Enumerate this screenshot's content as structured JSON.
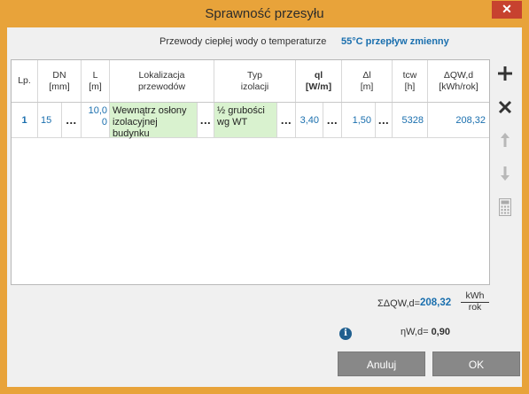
{
  "window": {
    "title": "Sprawność przesyłu",
    "close_symbol": "✕"
  },
  "subheader": {
    "label": "Przewody ciepłej wody o temperaturze",
    "value": "55°C przepływ zmienny"
  },
  "table": {
    "headers": {
      "lp": "Lp.",
      "dn_1": "DN",
      "dn_2": "[mm]",
      "l_1": "L",
      "l_2": "[m]",
      "lok_1": "Lokalizacja",
      "lok_2": "przewodów",
      "typ_1": "Typ",
      "typ_2": "izolacji",
      "ql_1": "ql",
      "ql_2": "[W/m]",
      "dl_1": "Δl",
      "dl_2": "[m]",
      "tcw_1": "tcw",
      "tcw_2": "[h]",
      "dq_1": "ΔQW,d",
      "dq_2": "[kWh/rok]"
    },
    "rows": [
      {
        "lp": "1",
        "dn": "15",
        "l_1": "10,0",
        "l_2": "0",
        "lok_1": "Wewnątrz osłony",
        "lok_2": "izolacyjnej budynku",
        "typ_1": "½ grubości",
        "typ_2": "wg WT",
        "ql": "3,40",
        "dl": "1,50",
        "tcw": "5328",
        "dq": "208,32"
      }
    ],
    "dots": "..."
  },
  "summary": {
    "sum_label": "ΣΔQW,d=",
    "sum_value": "208,32",
    "unit_top": "kWh",
    "unit_bottom": "rok",
    "eff_label": "ηW,d=",
    "eff_value": "0,90",
    "info_symbol": "i"
  },
  "buttons": {
    "cancel": "Anuluj",
    "ok": "OK"
  },
  "colors": {
    "accent": "#e8a33a",
    "link_blue": "#1a6fae",
    "green_cell": "#d9f2cf",
    "button_gray": "#888888"
  }
}
